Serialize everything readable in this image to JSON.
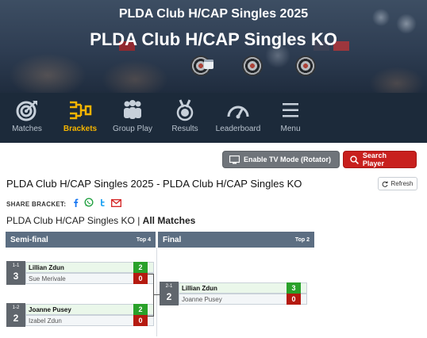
{
  "header": {
    "title": "PLDA Club H/CAP Singles 2025",
    "subtitle": "PLDA Club H/CAP Singles KO",
    "calendar_icon": "calendar-icon"
  },
  "nav": {
    "items": [
      {
        "label": "Matches",
        "icon": "target-icon",
        "active": false
      },
      {
        "label": "Brackets",
        "icon": "bracket-icon",
        "active": true
      },
      {
        "label": "Group Play",
        "icon": "group-icon",
        "active": false
      },
      {
        "label": "Results",
        "icon": "medal-icon",
        "active": false
      },
      {
        "label": "Leaderboard",
        "icon": "gauge-icon",
        "active": false
      },
      {
        "label": "Menu",
        "icon": "hamburger-icon",
        "active": false
      }
    ]
  },
  "actions": {
    "tv_mode_label": "Enable TV Mode (Rotator)",
    "search_label": "Search Player",
    "refresh_label": "Refresh"
  },
  "page": {
    "title": "PLDA Club H/CAP Singles 2025 - PLDA Club H/CAP Singles KO",
    "share_label": "SHARE BRACKET:",
    "share_icons": [
      "facebook-icon",
      "whatsapp-icon",
      "twitter-icon",
      "email-icon"
    ],
    "breadcrumb_event": "PLDA Club H/CAP Singles KO",
    "breadcrumb_sep": " | ",
    "breadcrumb_filter": "All Matches"
  },
  "colors": {
    "accent": "#f4b400",
    "nav_bg": "#1c2a3a",
    "win": "#2aa12a",
    "loss": "#b51a10",
    "search_button": "#c8201e",
    "round_header": "#5c6e82"
  },
  "bracket": {
    "rounds": [
      {
        "name": "Semi-final",
        "top": "Top 4"
      },
      {
        "name": "Final",
        "top": "Top 2"
      }
    ],
    "matches": [
      {
        "id": "1-1",
        "seed": "3",
        "p1": {
          "name": "Lillian Zdun",
          "score": "2",
          "winner": true
        },
        "p2": {
          "name": "Sue Merivale",
          "score": "0",
          "winner": false
        }
      },
      {
        "id": "1-2",
        "seed": "2",
        "p1": {
          "name": "Joanne Pusey",
          "score": "2",
          "winner": true
        },
        "p2": {
          "name": "Izabel Zdun",
          "score": "0",
          "winner": false
        }
      },
      {
        "id": "2-1",
        "seed": "2",
        "p1": {
          "name": "Lillian Zdun",
          "score": "3",
          "winner": true
        },
        "p2": {
          "name": "Joanne Pusey",
          "score": "0",
          "winner": false
        }
      }
    ]
  }
}
